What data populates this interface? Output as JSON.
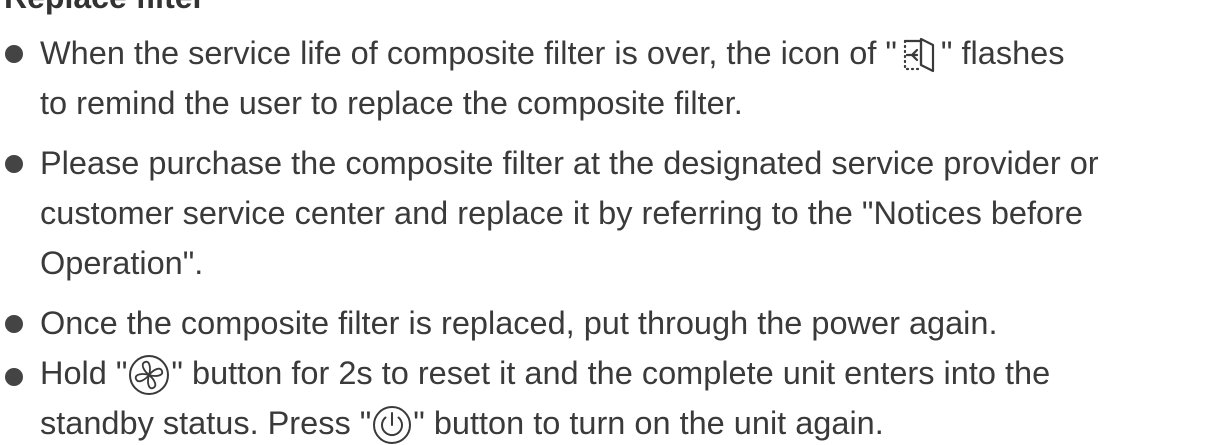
{
  "heading": "Replace filter",
  "items": [
    {
      "line1_before_icon": "When the service life of composite filter is over, the icon of \"",
      "line1_after_icon": "\" flashes",
      "line2": "to remind the user to replace the composite filter.",
      "icon": "filter-replace-icon"
    },
    {
      "line1": "Please purchase the composite filter at the designated service provider or",
      "line2": "customer service center and replace it by referring to the \"Notices before",
      "line3": "Operation\"."
    },
    {
      "line1": "Once the composite filter is replaced, put through the power again."
    },
    {
      "line1_before_icon": "Hold \"",
      "line1_after_icon": "\" button for 2s to reset it and the complete unit enters into the",
      "line2_before_icon": "standby status. Press \"",
      "line2_after_icon": "\" button to turn on the unit again.",
      "icon_1": "fan-icon",
      "icon_2": "power-icon"
    }
  ]
}
